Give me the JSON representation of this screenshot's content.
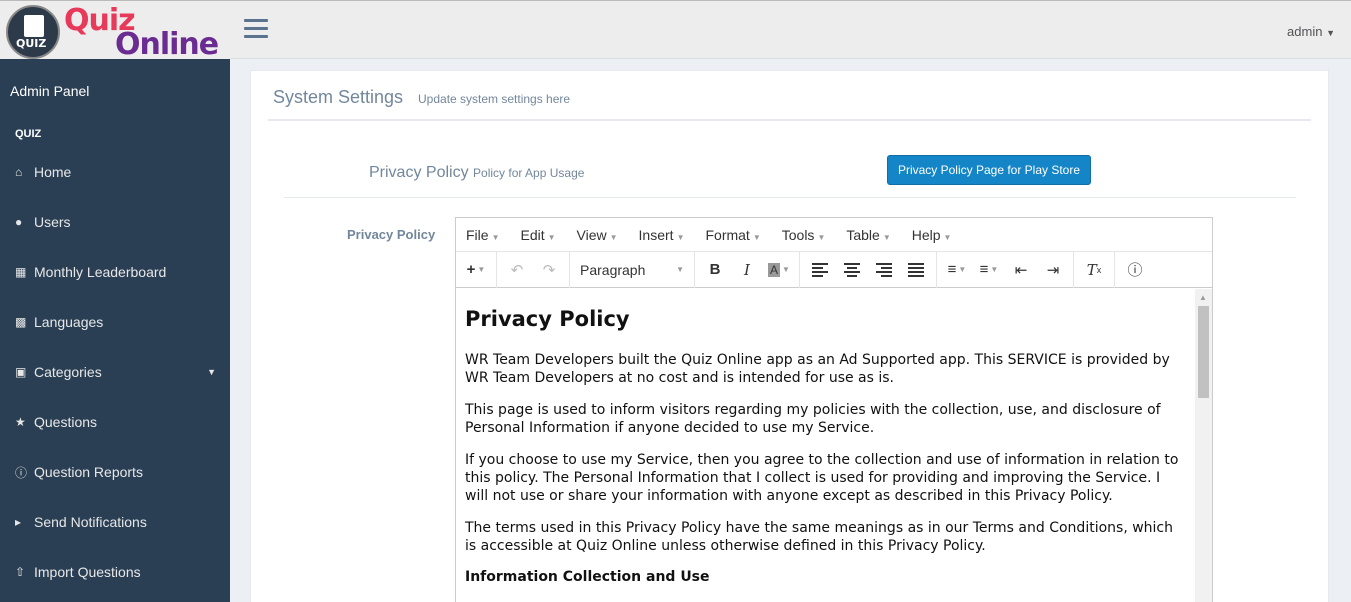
{
  "logo": {
    "quiz": "Quiz",
    "online": "Online",
    "badge": "QUIZ"
  },
  "sidebar": {
    "admin_panel": "Admin Panel",
    "section": "QUIZ",
    "items": [
      {
        "label": "Home",
        "icon": "home-icon"
      },
      {
        "label": "Users",
        "icon": "users-icon"
      },
      {
        "label": "Monthly Leaderboard",
        "icon": "table-icon"
      },
      {
        "label": "Languages",
        "icon": "language-icon"
      },
      {
        "label": "Categories",
        "icon": "gift-icon"
      },
      {
        "label": "Questions",
        "icon": "trophy-icon"
      },
      {
        "label": "Question Reports",
        "icon": "question-circle-icon"
      },
      {
        "label": "Send Notifications",
        "icon": "bullhorn-icon"
      },
      {
        "label": "Import Questions",
        "icon": "upload-icon"
      }
    ]
  },
  "topbar": {
    "user": "admin"
  },
  "page": {
    "title": "System Settings",
    "subtitle": "Update system settings here",
    "pp_heading": "Privacy Policy",
    "pp_heading_small": "Policy for App Usage",
    "play_store_button": "Privacy Policy Page for Play Store",
    "field_label": "Privacy Policy"
  },
  "editor": {
    "menus": [
      "File",
      "Edit",
      "View",
      "Insert",
      "Format",
      "Tools",
      "Table",
      "Help"
    ],
    "block_format": "Paragraph",
    "content": {
      "h1": "Privacy Policy",
      "p1": "WR Team Developers built the Quiz Online app as an Ad Supported app. This SERVICE is provided by WR Team Developers at no cost and is intended for use as is.",
      "p2": "This page is used to inform visitors regarding my policies with the collection, use, and disclosure of Personal Information if anyone decided to use my Service.",
      "p3": "If you choose to use my Service, then you agree to the collection and use of information in relation to this policy. The Personal Information that I collect is used for providing and improving the Service. I will not use or share your information with anyone except as described in this Privacy Policy.",
      "p4": "The terms used in this Privacy Policy have the same meanings as in our Terms and Conditions, which is accessible at Quiz Online unless otherwise defined in this Privacy Policy.",
      "h3": "Information Collection and Use"
    }
  }
}
